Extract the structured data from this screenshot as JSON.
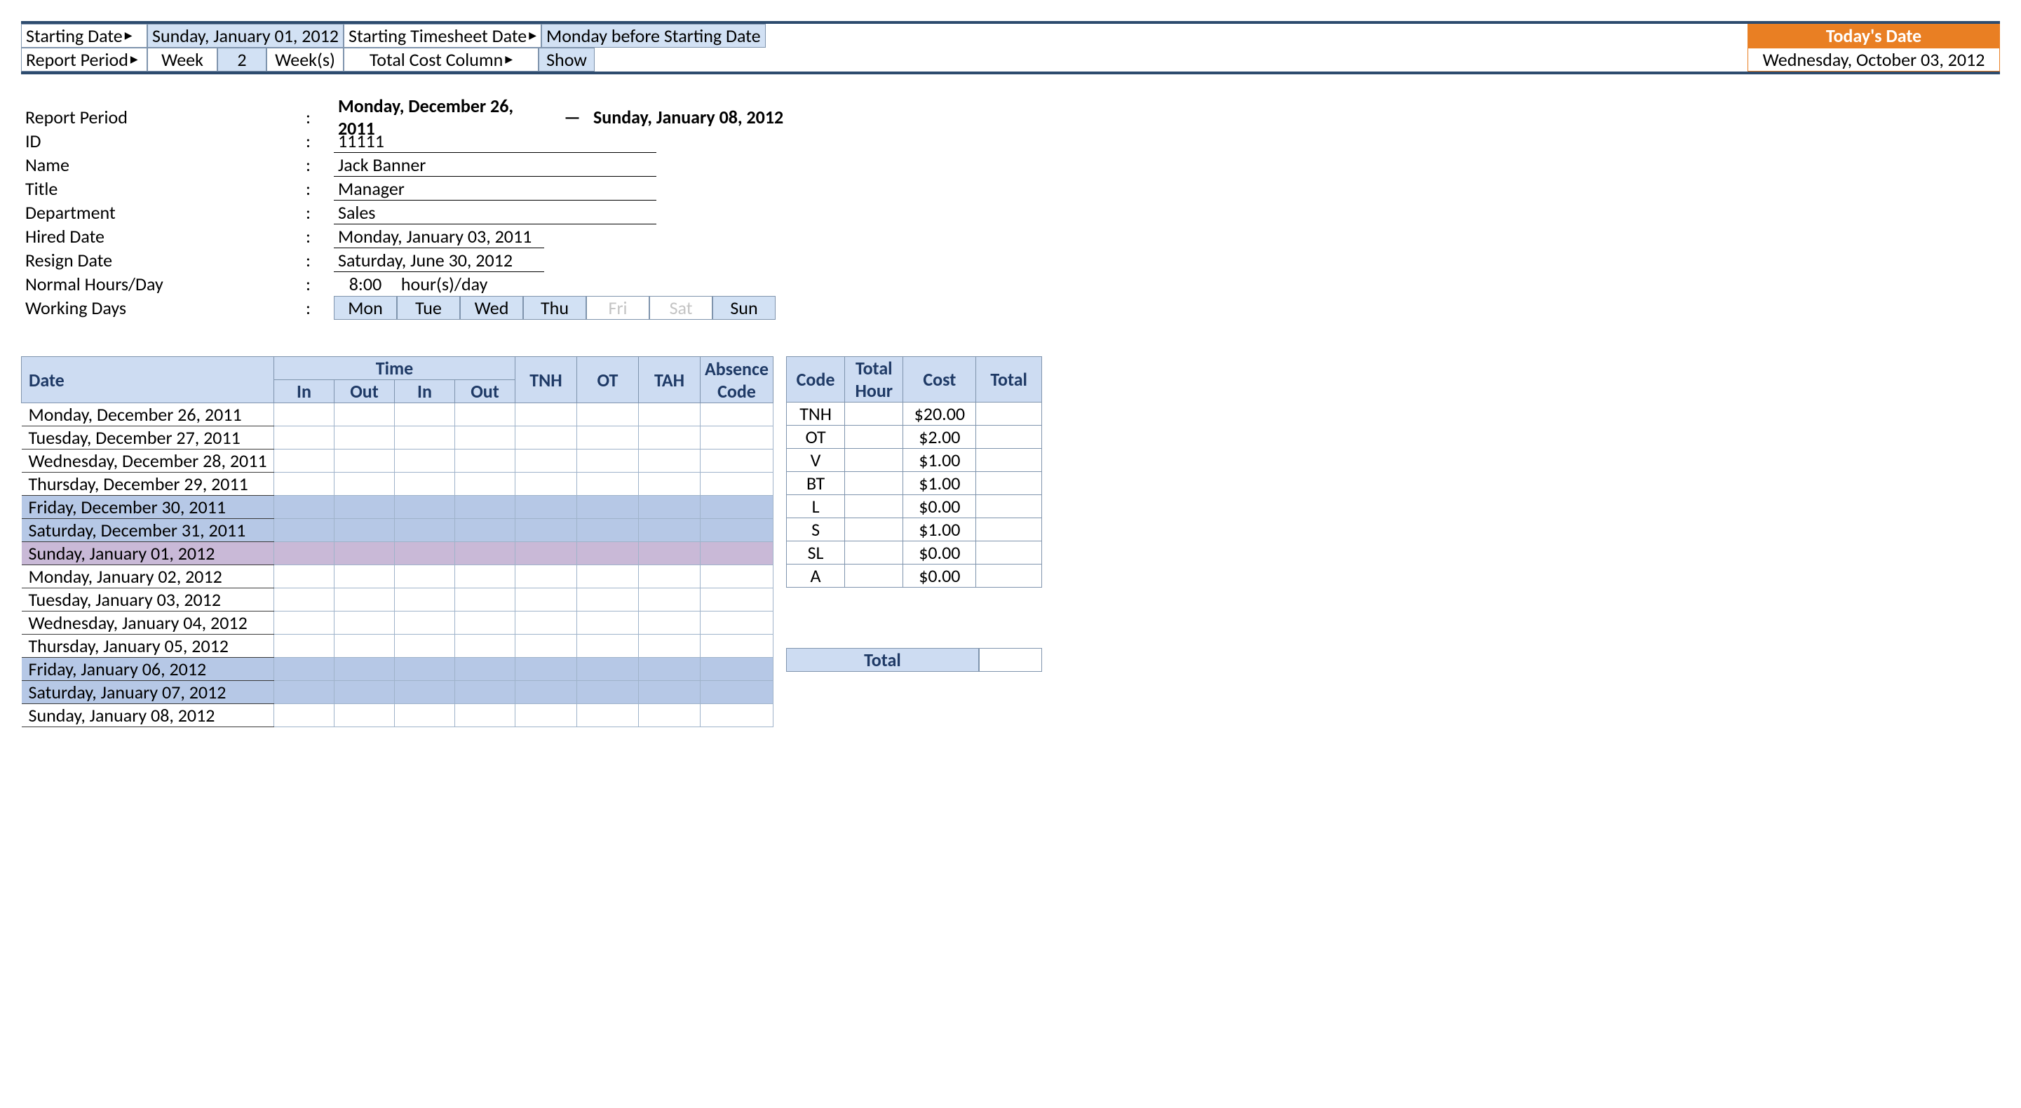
{
  "top": {
    "starting_date_label": "Starting Date",
    "starting_date_value": "Sunday, January 01, 2012",
    "starting_ts_label": "Starting Timesheet Date",
    "starting_ts_value": "Monday before Starting Date",
    "report_period_label": "Report Period",
    "report_period_unit_label": "Week",
    "report_period_count": "2",
    "report_period_plural": "Week(s)",
    "total_cost_label": "Total Cost Column",
    "total_cost_value": "Show",
    "today_label": "Today's Date",
    "today_value": "Wednesday, October 03, 2012"
  },
  "info": {
    "report_period_label": "Report Period",
    "report_period_start": "Monday, December 26, 2011",
    "report_period_dash": "—",
    "report_period_end": "Sunday, January 08, 2012",
    "id_label": "ID",
    "id_value": "11111",
    "name_label": "Name",
    "name_value": "Jack Banner",
    "title_label": "Title",
    "title_value": "Manager",
    "dept_label": "Department",
    "dept_value": "Sales",
    "hired_label": "Hired Date",
    "hired_value": "Monday, January 03, 2011",
    "resign_label": "Resign Date",
    "resign_value": "Saturday, June 30, 2012",
    "normal_label": "Normal Hours/Day",
    "normal_hours": "8:00",
    "normal_unit": "hour(s)/day",
    "working_label": "Working Days",
    "days": [
      "Mon",
      "Tue",
      "Wed",
      "Thu",
      "Fri",
      "Sat",
      "Sun"
    ],
    "days_on": [
      true,
      true,
      true,
      true,
      false,
      false,
      true
    ]
  },
  "ts": {
    "head_date": "Date",
    "head_time": "Time",
    "head_in": "In",
    "head_out": "Out",
    "head_tnh": "TNH",
    "head_ot": "OT",
    "head_tah": "TAH",
    "head_abs": "Absence Code",
    "rows": [
      {
        "date": "Monday, December 26, 2011",
        "shade": ""
      },
      {
        "date": "Tuesday, December 27, 2011",
        "shade": ""
      },
      {
        "date": "Wednesday, December 28, 2011",
        "shade": ""
      },
      {
        "date": "Thursday, December 29, 2011",
        "shade": ""
      },
      {
        "date": "Friday, December 30, 2011",
        "shade": "blue"
      },
      {
        "date": "Saturday, December 31, 2011",
        "shade": "blue"
      },
      {
        "date": "Sunday, January 01, 2012",
        "shade": "purple"
      },
      {
        "date": "Monday, January 02, 2012",
        "shade": ""
      },
      {
        "date": "Tuesday, January 03, 2012",
        "shade": ""
      },
      {
        "date": "Wednesday, January 04, 2012",
        "shade": ""
      },
      {
        "date": "Thursday, January 05, 2012",
        "shade": ""
      },
      {
        "date": "Friday, January 06, 2012",
        "shade": "blue"
      },
      {
        "date": "Saturday, January 07, 2012",
        "shade": "blue"
      },
      {
        "date": "Sunday, January 08, 2012",
        "shade": ""
      }
    ]
  },
  "costs": {
    "head_code": "Code",
    "head_hour": "Total Hour",
    "head_cost": "Cost",
    "head_total": "Total",
    "rows": [
      {
        "code": "TNH",
        "hour": "",
        "cost": "$20.00",
        "total": ""
      },
      {
        "code": "OT",
        "hour": "",
        "cost": "$2.00",
        "total": ""
      },
      {
        "code": "V",
        "hour": "",
        "cost": "$1.00",
        "total": ""
      },
      {
        "code": "BT",
        "hour": "",
        "cost": "$1.00",
        "total": ""
      },
      {
        "code": "L",
        "hour": "",
        "cost": "$0.00",
        "total": ""
      },
      {
        "code": "S",
        "hour": "",
        "cost": "$1.00",
        "total": ""
      },
      {
        "code": "SL",
        "hour": "",
        "cost": "$0.00",
        "total": ""
      },
      {
        "code": "A",
        "hour": "",
        "cost": "$0.00",
        "total": ""
      }
    ],
    "total_label": "Total",
    "total_value": ""
  }
}
